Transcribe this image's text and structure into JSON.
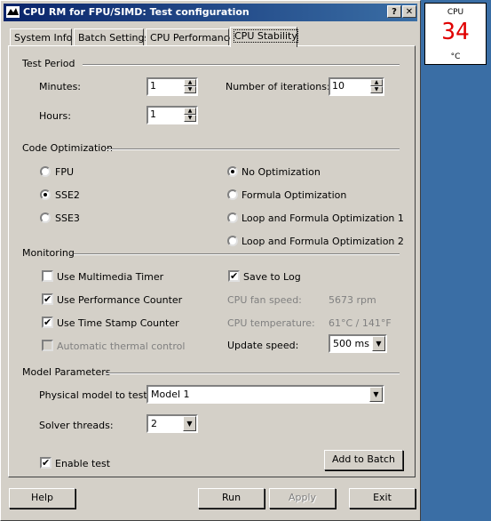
{
  "window": {
    "title": "CPU RM for FPU/SIMD: Test configuration",
    "help_glyph": "?",
    "close_glyph": "✕"
  },
  "tabs": [
    {
      "label": "System Info"
    },
    {
      "label": "Batch Settings"
    },
    {
      "label": "CPU Performance"
    },
    {
      "label": "CPU Stability",
      "active": true
    }
  ],
  "test_period": {
    "heading": "Test Period",
    "minutes_label": "Minutes:",
    "minutes_value": "1",
    "hours_label": "Hours:",
    "hours_value": "1",
    "iterations_label": "Number of iterations:",
    "iterations_value": "10"
  },
  "code_optimization": {
    "heading": "Code Optimization",
    "options": [
      "FPU",
      "SSE2",
      "SSE3"
    ],
    "selected_option": "SSE2",
    "modes": [
      "No Optimization",
      "Formula Optimization",
      "Loop and Formula Optimization 1",
      "Loop and Formula Optimization 2"
    ],
    "selected_mode": "No Optimization"
  },
  "monitoring": {
    "heading": "Monitoring",
    "multimedia_timer": "Use Multimedia Timer",
    "performance_counter": "Use Performance Counter",
    "time_stamp_counter": "Use Time Stamp Counter",
    "thermal_control": "Automatic thermal control",
    "save_to_log": "Save to Log",
    "fan_speed_label": "CPU fan speed:",
    "fan_speed_value": "5673 rpm",
    "temperature_label": "CPU temperature:",
    "temperature_value": "61°C / 141°F",
    "update_speed_label": "Update speed:",
    "update_speed_value": "500 ms"
  },
  "model": {
    "heading": "Model Parameters",
    "physical_model_label": "Physical model to test:",
    "physical_model_value": "Model 1",
    "solver_threads_label": "Solver threads:",
    "solver_threads_value": "2",
    "enable_test": "Enable test",
    "add_to_batch": "Add to Batch"
  },
  "buttons": {
    "help": "Help",
    "run": "Run",
    "apply": "Apply",
    "exit": "Exit"
  },
  "gadget": {
    "label": "CPU",
    "value": "34",
    "unit": "°C",
    "value_color": "#e00000"
  },
  "check_glyph": "✔",
  "colors": {
    "title_start": "#0a246a",
    "title_end": "#3a6ea5",
    "face": "#d4d0c8",
    "desktop": "#3a6ea5"
  }
}
